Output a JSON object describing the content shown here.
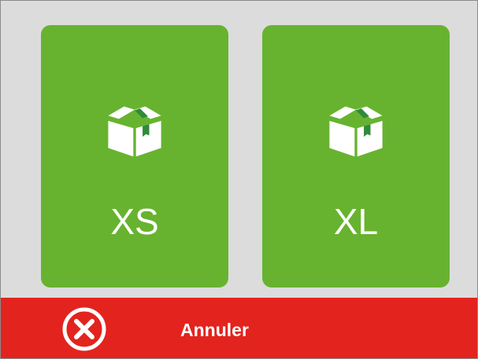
{
  "tiles": [
    {
      "label": "XS",
      "icon": "package-box-icon"
    },
    {
      "label": "XL",
      "icon": "package-box-icon"
    }
  ],
  "cancel": {
    "label": "Annuler",
    "icon": "close-circle-icon"
  },
  "colors": {
    "background": "#dcdcdc",
    "tile": "#67b32f",
    "cancel_bar": "#e3231e",
    "text": "#ffffff",
    "box_tape": "#2e8b3a"
  }
}
